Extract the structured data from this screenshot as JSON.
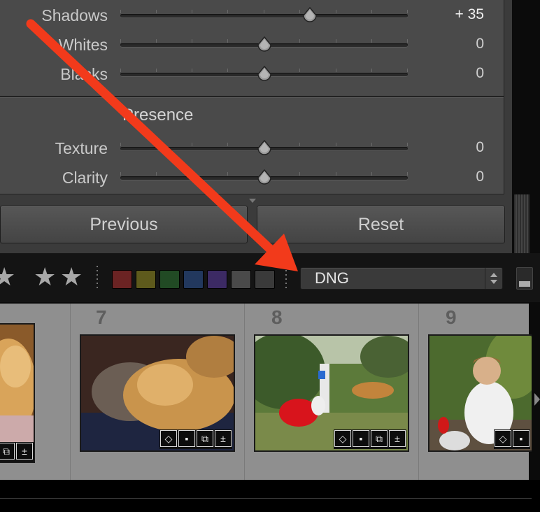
{
  "panel": {
    "tone_sliders": [
      {
        "label": "Shadows",
        "value": "+ 35",
        "position": 0.66
      },
      {
        "label": "Whites",
        "value": "0",
        "position": 0.5
      },
      {
        "label": "Blacks",
        "value": "0",
        "position": 0.5
      }
    ],
    "presence": {
      "header": "Presence",
      "sliders": [
        {
          "label": "Texture",
          "value": "0",
          "position": 0.5
        },
        {
          "label": "Clarity",
          "value": "0",
          "position": 0.5
        }
      ]
    },
    "buttons": {
      "previous": "Previous",
      "reset": "Reset"
    }
  },
  "toolbar": {
    "stars": [
      "★",
      "★",
      "★"
    ],
    "color_labels": [
      "#6b2323",
      "#5e5a1c",
      "#214a24",
      "#22385e",
      "#3c2a64",
      "#4a4a4a",
      "#3a3a3a"
    ],
    "filter_select": {
      "value": "DNG"
    }
  },
  "filmstrip": {
    "cells": [
      {
        "number": ""
      },
      {
        "number": "7"
      },
      {
        "number": "8"
      },
      {
        "number": "9"
      }
    ]
  },
  "colors": {
    "annotation_arrow": "#f23a1b"
  }
}
